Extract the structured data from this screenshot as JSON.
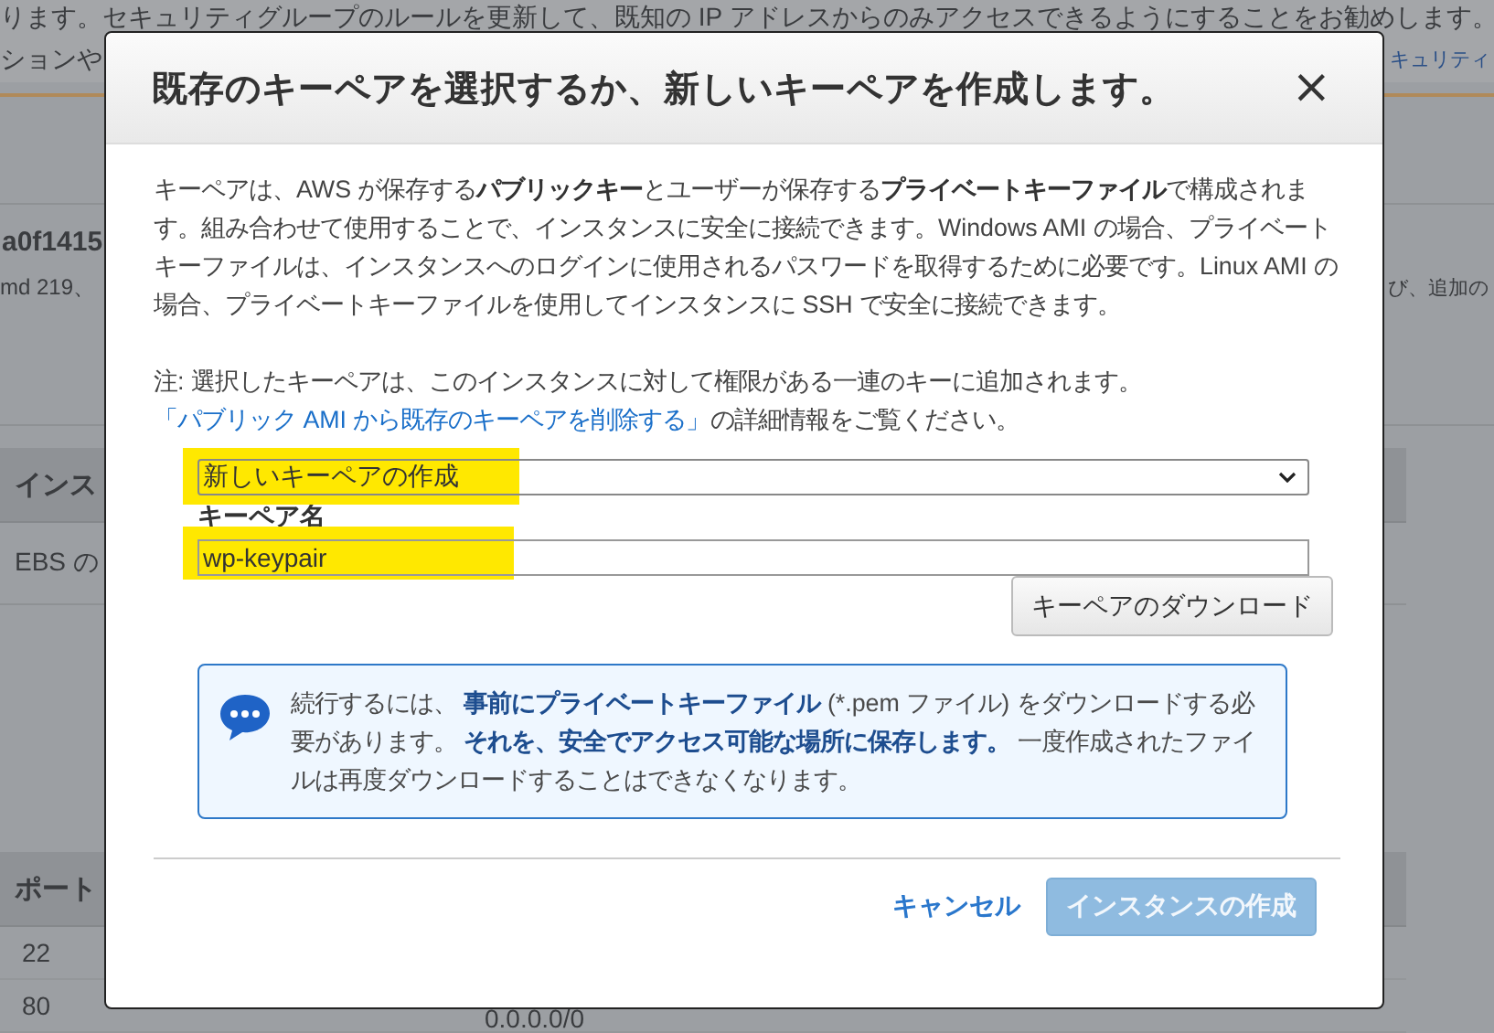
{
  "background": {
    "notice_line": "ります。セキュリティグループのルールを更新して、既知の IP アドレスからのみアクセスできるようにすることをお勧めします。",
    "second_line_left": "ションや",
    "second_line_right": "キュリティ",
    "ami_id": "a0f1415",
    "ami_desc": "md 219、",
    "ami_desc_right": "び、追加の",
    "table1_header": "インス",
    "table1_cell": "EBS の",
    "table2_header": "ポート",
    "table2_rows": [
      {
        "port": "22",
        "source": ""
      },
      {
        "port": "80",
        "source": "0.0.0.0/0"
      }
    ]
  },
  "modal": {
    "title": "既存のキーペアを選択するか、新しいキーペアを作成します。",
    "close": "×",
    "intro": "キーペアは、AWS が保存する**パブリックキー**とユーザーが保存する**プライベートキーファイル**で構成されます。組み合わせて使用することで、インスタンスに安全に接続できます。Windows AMI の場合、プライベートキーファイルは、インスタンスへのログインに使用されるパスワードを取得するために必要です。Linux AMI の場合、プライベートキーファイルを使用してインスタンスに SSH で安全に接続できます。",
    "note_before": "注: 選択したキーペアは、このインスタンスに対して権限がある一連のキーに追加されます。",
    "note_link": "「パブリック AMI から既存のキーペアを削除する」",
    "note_after": "の詳細情報をご覧ください。",
    "select": {
      "value": "新しいキーペアの作成",
      "highlighted": true
    },
    "name_label": "キーペア名",
    "name_input": {
      "value": "wp-keypair",
      "highlighted": true
    },
    "download_button": "キーペアのダウンロード",
    "info": "続行するには、 **事前にプライベートキーファイル** (*.pem ファイル) をダウンロードする必要があります。 **それを、安全でアクセス可能な場所に保存します。** 一度作成されたファイルは再度ダウンロードすることはできなくなります。",
    "cancel": "キャンセル",
    "create_button": {
      "label": "インスタンスの作成",
      "disabled": true
    }
  }
}
